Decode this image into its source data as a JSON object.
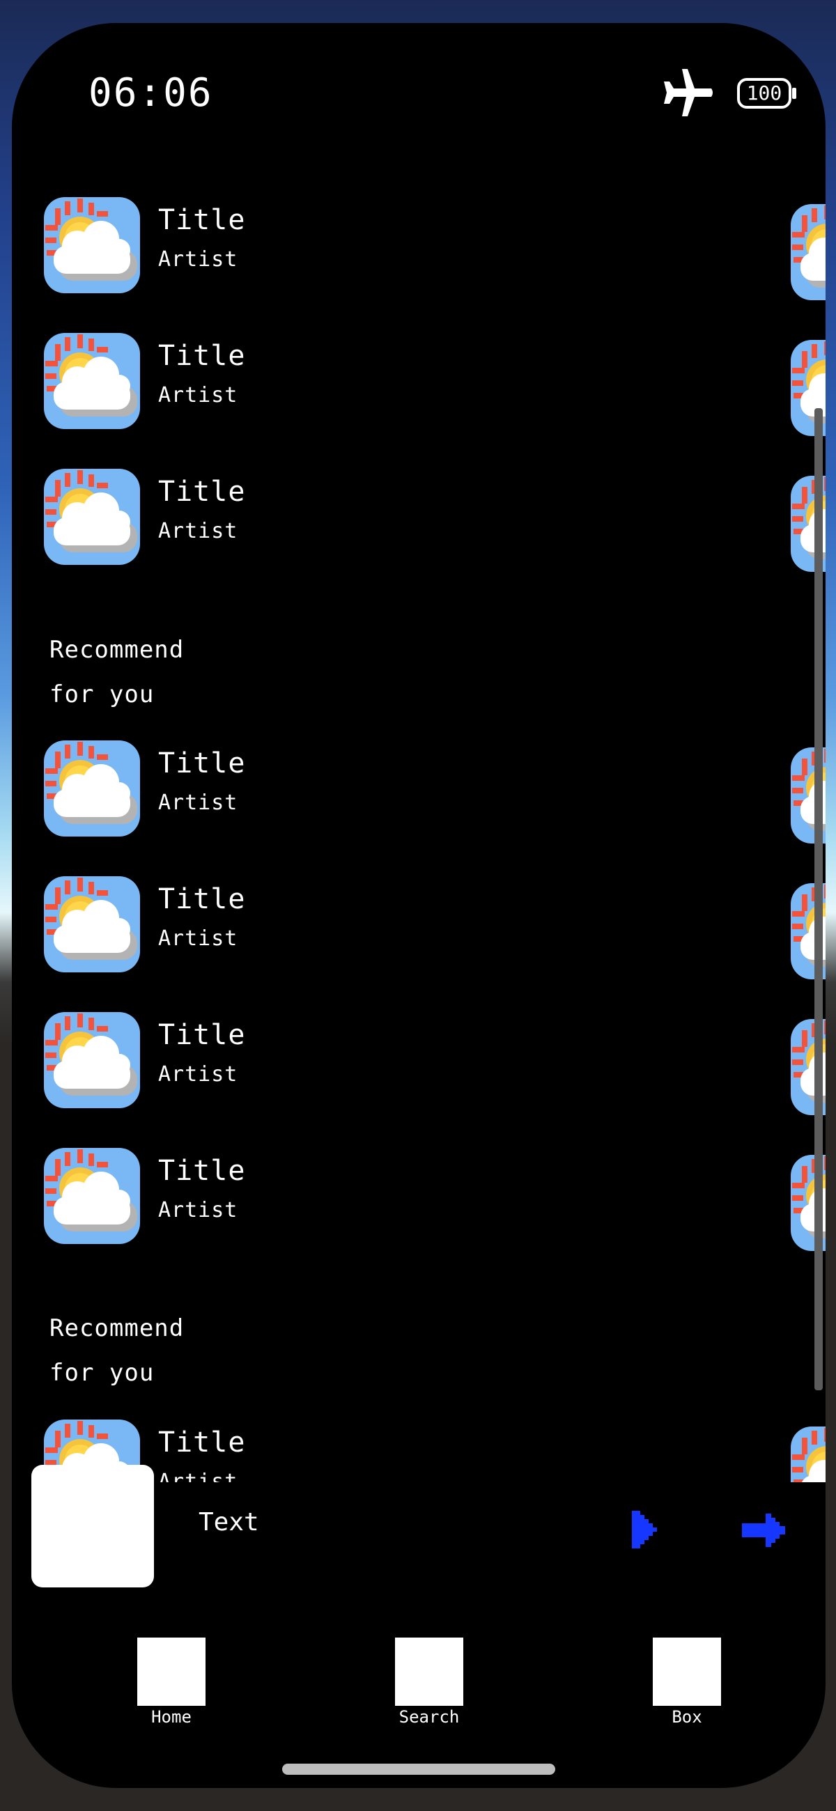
{
  "status_bar": {
    "time": "06:06",
    "battery_level": "100",
    "icons": [
      "airplane-icon",
      "battery-icon"
    ]
  },
  "list": {
    "section_1_items": [
      {
        "title": "Title",
        "artist": "Artist"
      },
      {
        "title": "Title",
        "artist": "Artist"
      },
      {
        "title": "Title",
        "artist": "Artist"
      }
    ],
    "section_2_heading": "Recommend\nfor you",
    "section_2_items": [
      {
        "title": "Title",
        "artist": "Artist"
      },
      {
        "title": "Title",
        "artist": "Artist"
      },
      {
        "title": "Title",
        "artist": "Artist"
      },
      {
        "title": "Title",
        "artist": "Artist"
      }
    ],
    "section_3_heading": "Recommend\nfor you",
    "section_3_items": [
      {
        "title": "Title",
        "artist": "Artist"
      }
    ],
    "cover_icon": "partly-cloudy-icon"
  },
  "mini_player": {
    "text": "Text",
    "play_icon": "play-icon",
    "next_icon": "next-arrow-icon"
  },
  "tab_bar": {
    "items": [
      {
        "label": "Home"
      },
      {
        "label": "Search"
      },
      {
        "label": "Box"
      }
    ]
  },
  "colors": {
    "background": "#000000",
    "accent": "#1637ff",
    "text": "#ffffff",
    "cover_bg": "#7ab8f5"
  }
}
